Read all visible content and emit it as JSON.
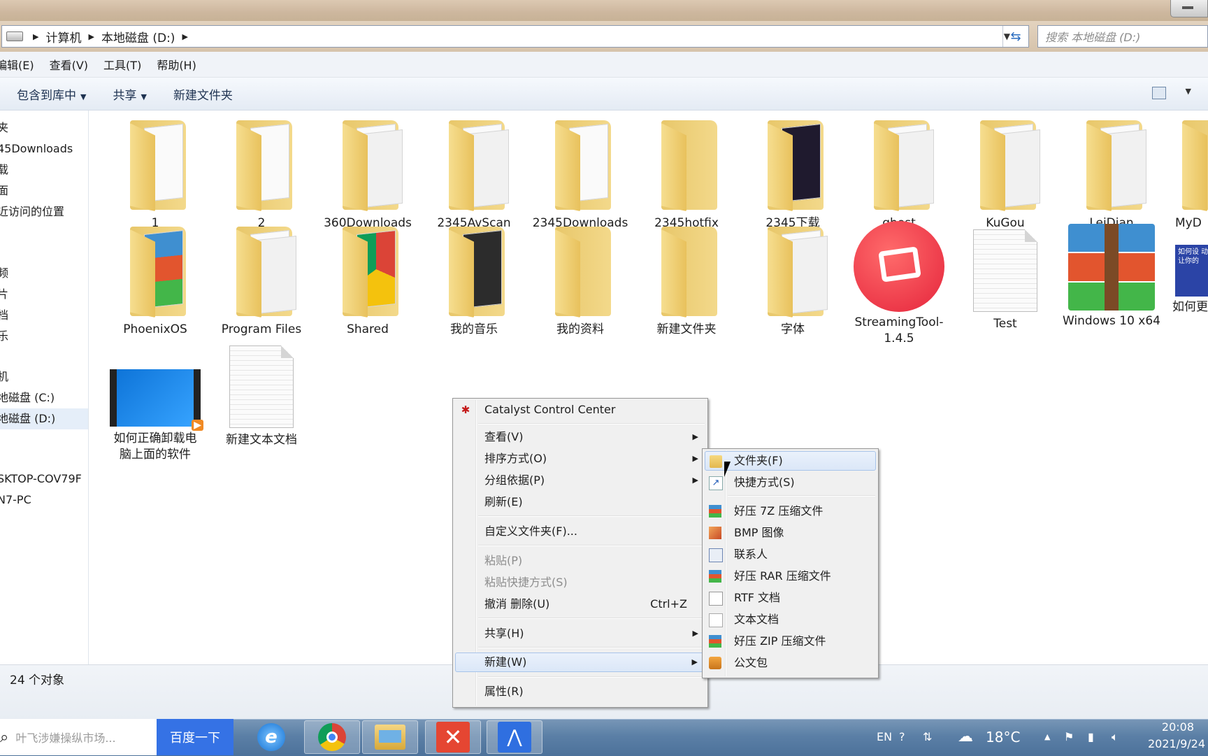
{
  "breadcrumb": [
    "计算机",
    "本地磁盘 (D:)"
  ],
  "search": {
    "placeholder": "搜索 本地磁盘 (D:)"
  },
  "menubar": [
    "编辑(E)",
    "查看(V)",
    "工具(T)",
    "帮助(H)"
  ],
  "toolbar": {
    "include_library": "包含到库中",
    "share": "共享",
    "new_folder": "新建文件夹"
  },
  "nav": [
    "夹",
    "45Downloads",
    "载",
    "面",
    "近访问的位置",
    "频",
    "片",
    "档",
    "乐",
    "机",
    "地磁盘 (C:)",
    "地磁盘 (D:)",
    "SKTOP-COV79F",
    "N7-PC"
  ],
  "files_row1": [
    "1",
    "2",
    "360Downloads",
    "2345AvScan",
    "2345Downloads",
    "2345hotfix",
    "2345下载",
    "ghost",
    "KuGou",
    "LeiDian",
    "MyD"
  ],
  "files_row2": [
    "PhoenixOS",
    "Program Files",
    "Shared",
    "我的音乐",
    "我的资料",
    "新建文件夹",
    "字体",
    "StreamingTool-1.4.5",
    "Test",
    "Windows 10 x64",
    "如何更"
  ],
  "files_row3": [
    "如何正确卸载电脑上面的软件",
    "新建文本文档"
  ],
  "thumb_text": "如何设 动清理 让你的",
  "status": "24 个对象",
  "context_menu": {
    "catalyst": "Catalyst Control Center",
    "view": "查看(V)",
    "sort": "排序方式(O)",
    "group": "分组依据(P)",
    "refresh": "刷新(E)",
    "customize": "自定义文件夹(F)...",
    "paste": "粘贴(P)",
    "paste_shortcut": "粘贴快捷方式(S)",
    "undo": "撤消 删除(U)",
    "undo_shortcut": "Ctrl+Z",
    "share": "共享(H)",
    "new": "新建(W)",
    "properties": "属性(R)"
  },
  "submenu": [
    "文件夹(F)",
    "快捷方式(S)",
    "好压 7Z 压缩文件",
    "BMP 图像",
    "联系人",
    "好压 RAR 压缩文件",
    "RTF 文档",
    "文本文档",
    "好压 ZIP 压缩文件",
    "公文包"
  ],
  "taskbar": {
    "search_text": "叶飞涉嫌操纵市场...",
    "search_button": "百度一下",
    "lang": "EN",
    "temp": "18°C",
    "time": "20:08",
    "date": "2021/9/24"
  }
}
